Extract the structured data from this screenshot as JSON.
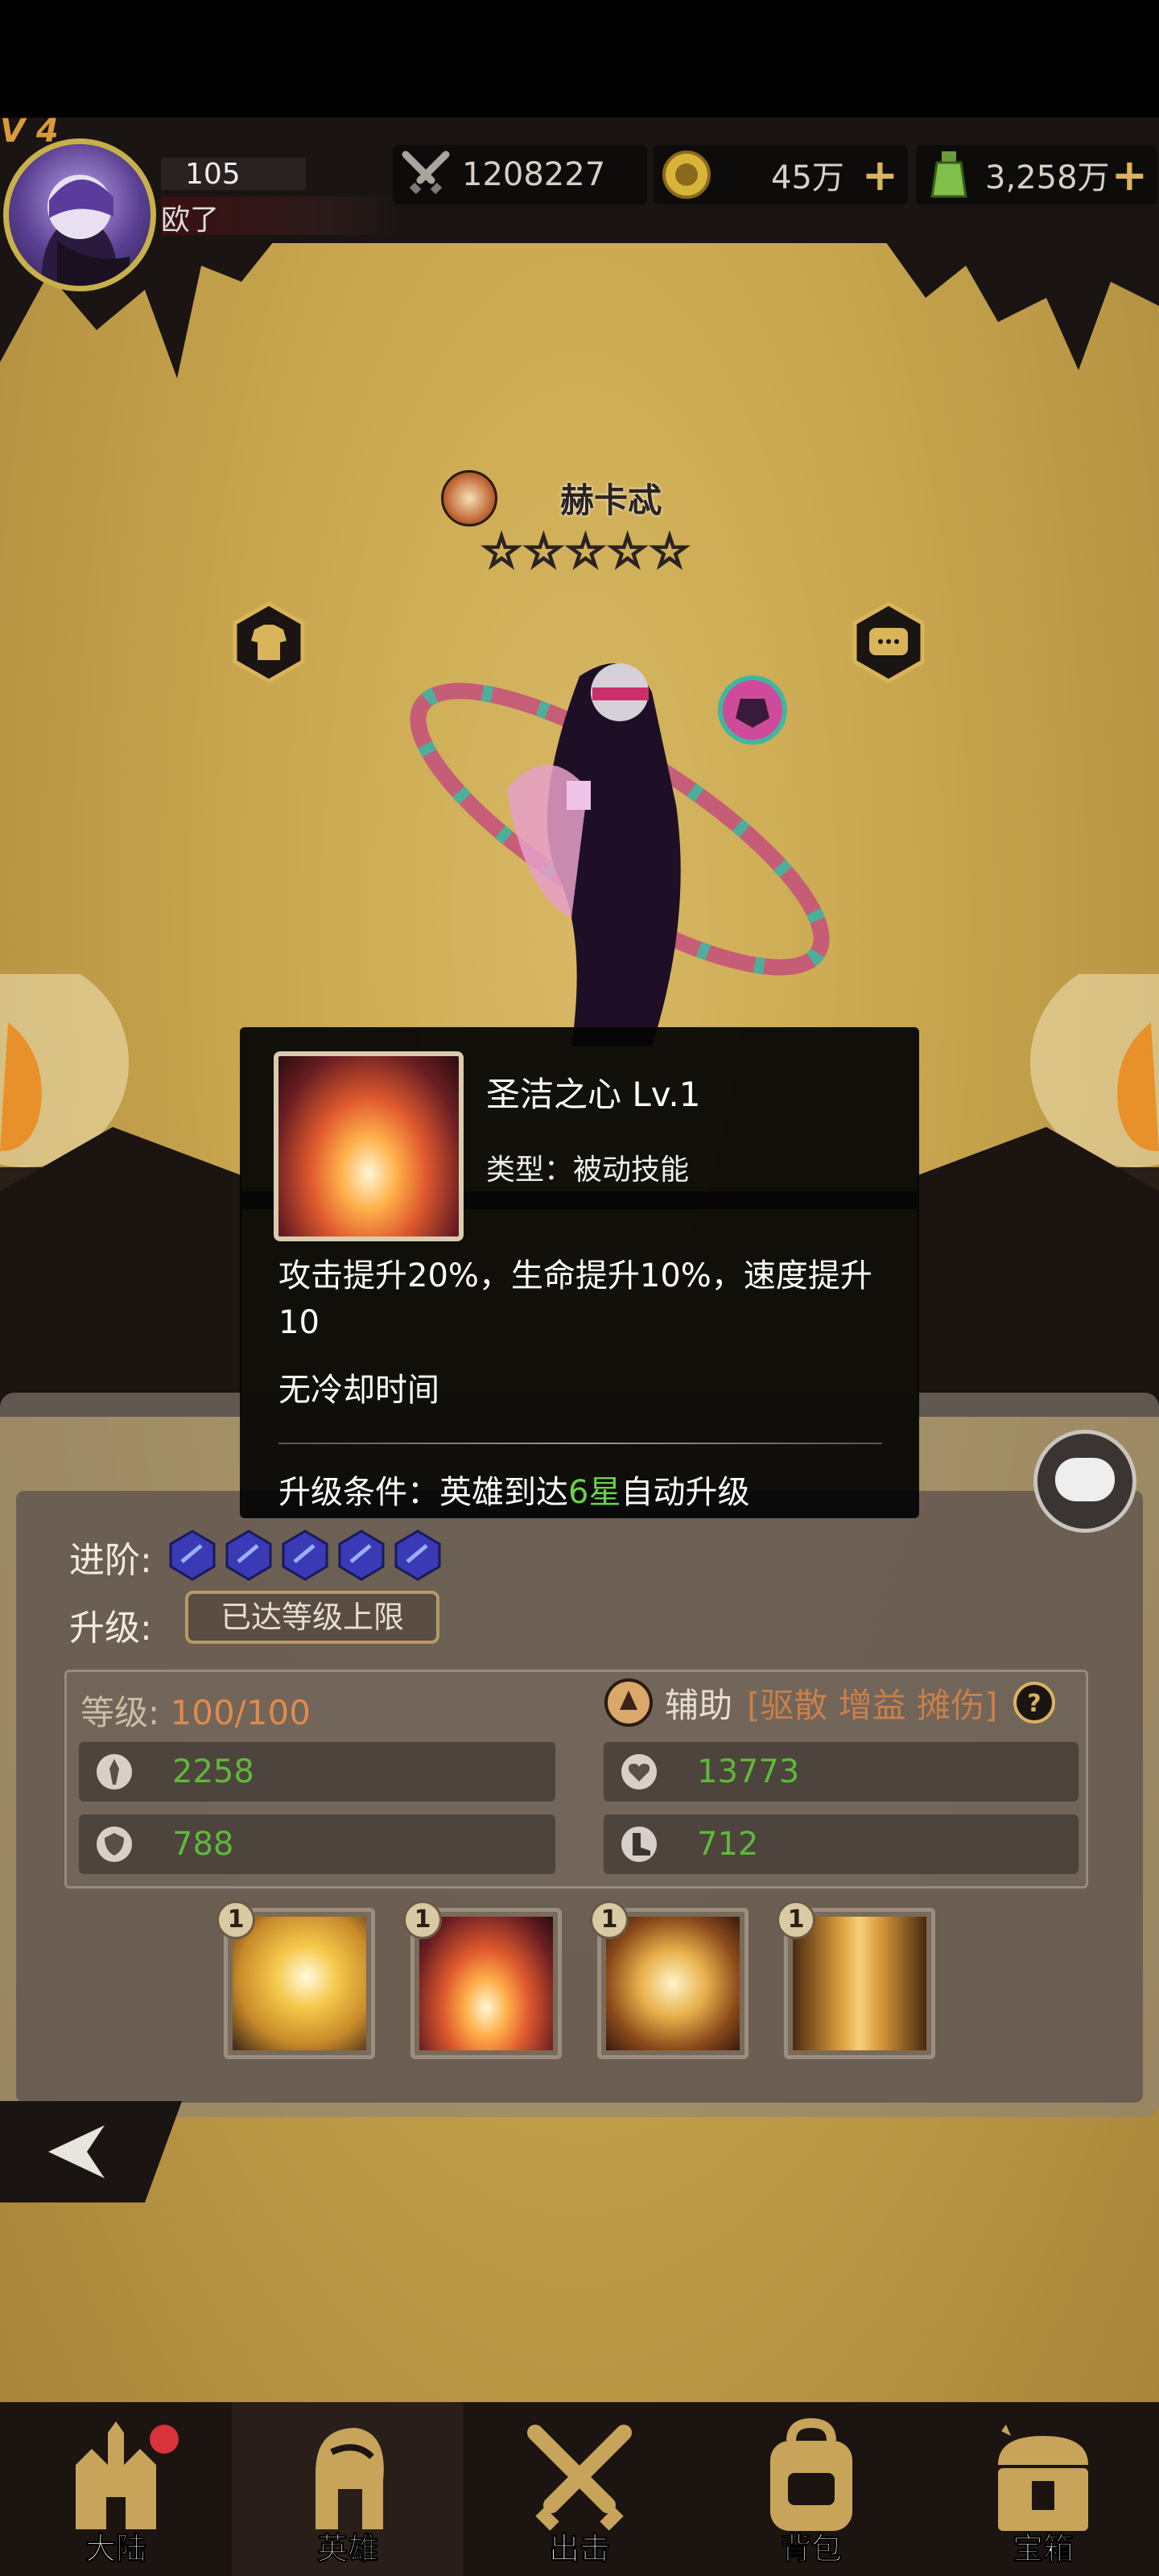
{
  "header": {
    "vip": "V 4",
    "level": "105",
    "player_name": "欧了",
    "power": "1208227",
    "gold": "45万",
    "potion": "3,258万"
  },
  "hero": {
    "name": "赫卡忒",
    "stars": [
      "☆",
      "☆",
      "☆",
      "☆",
      "☆"
    ]
  },
  "tooltip": {
    "title": "圣洁之心  Lv.1",
    "type": "类型：被动技能",
    "description": "攻击提升20%，生命提升10%，速度提升10",
    "cooldown": "无冷却时间",
    "upgrade_prefix": "升级条件：英雄到达",
    "upgrade_highlight": "6星",
    "upgrade_suffix": "自动升级"
  },
  "panel": {
    "advance_label": "进阶:",
    "upgrade_label": "升级:",
    "max_level_button": "已达等级上限",
    "level_label": "等级:",
    "level_value": "100/100",
    "role": "辅助",
    "role_tags": "[驱散 增益 摊伤]",
    "stats": {
      "attack": "2258",
      "hp": "13773",
      "defense": "788",
      "speed": "712"
    },
    "skill_levels": [
      "1",
      "1",
      "1",
      "1"
    ]
  },
  "nav": {
    "items": [
      "大陆",
      "英雄",
      "出击",
      "背包",
      "宝箱"
    ],
    "active": "英雄"
  },
  "colors": {
    "accent_gold": "#d9b45a",
    "highlight_green": "#6ecf4a",
    "stat_green": "#5fb83a",
    "tag_orange": "#c8804a"
  }
}
